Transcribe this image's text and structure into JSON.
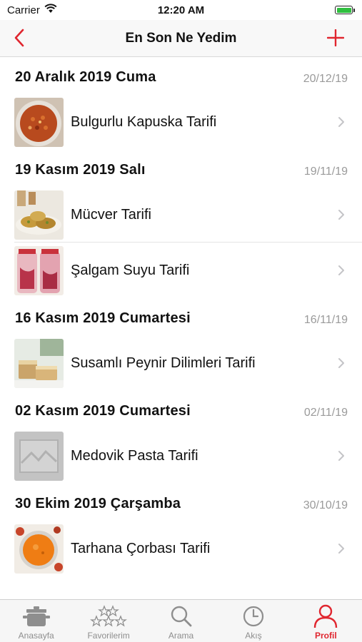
{
  "status_bar": {
    "carrier": "Carrier",
    "time": "12:20 AM"
  },
  "nav": {
    "title": "En Son Ne Yedim",
    "back_icon": "chevron-left-icon",
    "add_icon": "plus-icon"
  },
  "colors": {
    "accent": "#e0262f",
    "date_gray": "#9a9a9a",
    "tab_gray": "#8e8e8e"
  },
  "sections": [
    {
      "title": "20 Aralık 2019 Cuma",
      "date": "20/12/19",
      "items": [
        {
          "label": "Bulgurlu Kapuska Tarifi",
          "thumb": "kapuska"
        }
      ]
    },
    {
      "title": "19 Kasım 2019 Salı",
      "date": "19/11/19",
      "items": [
        {
          "label": "Mücver Tarifi",
          "thumb": "mucver"
        },
        {
          "label": "Şalgam Suyu Tarifi",
          "thumb": "salgam"
        }
      ]
    },
    {
      "title": "16 Kasım 2019 Cumartesi",
      "date": "16/11/19",
      "items": [
        {
          "label": "Susamlı Peynir Dilimleri Tarifi",
          "thumb": "peynir"
        }
      ]
    },
    {
      "title": "02 Kasım 2019 Cumartesi",
      "date": "02/11/19",
      "items": [
        {
          "label": "Medovik Pasta Tarifi",
          "thumb": "placeholder"
        }
      ]
    },
    {
      "title": "30 Ekim 2019 Çarşamba",
      "date": "30/10/19",
      "items": [
        {
          "label": "Tarhana Çorbası Tarifi",
          "thumb": "tarhana"
        }
      ]
    }
  ],
  "tabs": [
    {
      "label": "Anasayfa",
      "icon": "pot-icon",
      "active": false
    },
    {
      "label": "Favorilerim",
      "icon": "stars-icon",
      "active": false
    },
    {
      "label": "Arama",
      "icon": "search-icon",
      "active": false
    },
    {
      "label": "Akış",
      "icon": "clock-icon",
      "active": false
    },
    {
      "label": "Profil",
      "icon": "person-icon",
      "active": true
    }
  ]
}
